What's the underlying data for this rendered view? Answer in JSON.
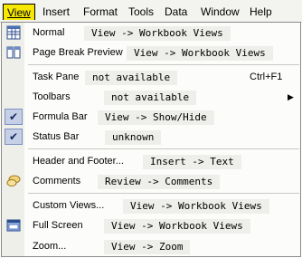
{
  "menubar": {
    "items": [
      "View",
      "Insert",
      "Format",
      "Tools",
      "Data",
      "Window",
      "Help"
    ]
  },
  "menu": {
    "items": [
      {
        "label": "Normal",
        "shortcut": "View -> Workbook Views"
      },
      {
        "label": "Page Break Preview",
        "shortcut": "View -> Workbook Views"
      },
      {
        "label": "Task Pane",
        "shortcut": "not available",
        "key": "Ctrl+F1"
      },
      {
        "label": "Toolbars",
        "shortcut": "not available"
      },
      {
        "label": "Formula Bar",
        "shortcut": "View -> Show/Hide"
      },
      {
        "label": "Status Bar",
        "shortcut": "unknown"
      },
      {
        "label": "Header and Footer...",
        "shortcut": "Insert -> Text"
      },
      {
        "label": "Comments",
        "shortcut": "Review -> Comments"
      },
      {
        "label": "Custom Views...",
        "shortcut": "View -> Workbook Views"
      },
      {
        "label": "Full Screen",
        "shortcut": "View -> Workbook Views"
      },
      {
        "label": "Zoom...",
        "shortcut": "View -> Zoom"
      }
    ],
    "checkmark": "✔",
    "submenu_arrow": "▶"
  },
  "colors": {
    "active_menu": "#f6e800",
    "shortcut_bg": "#eeeeea",
    "check_bg": "#c5cfe6"
  }
}
